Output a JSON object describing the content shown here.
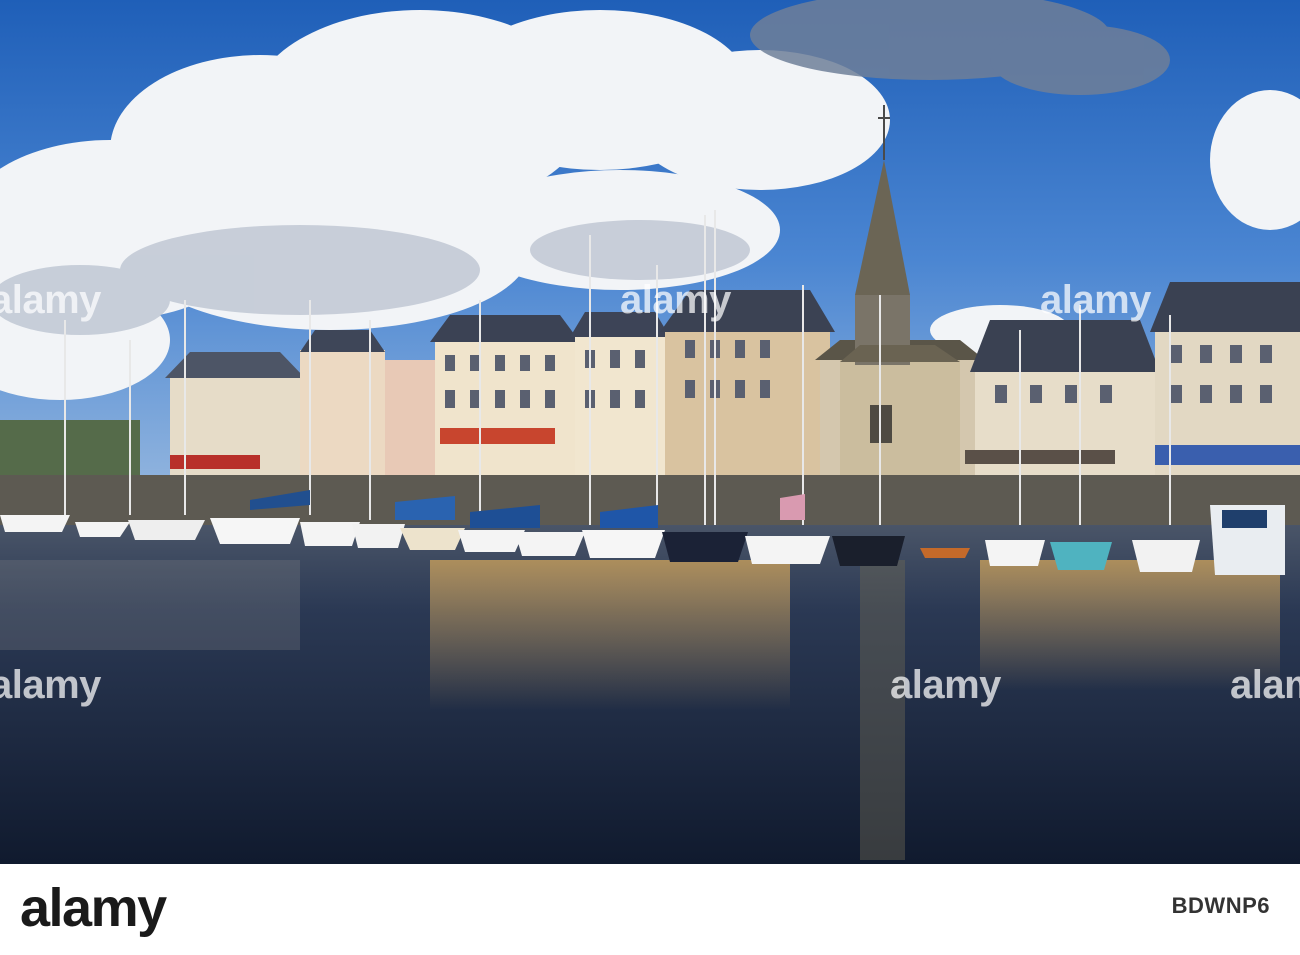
{
  "photo": {
    "subject": "harbour-with-boats-and-church-spire",
    "colors": {
      "sky_top": "#1f5fb8",
      "cloud": "#f2f4f7",
      "water": "#1b2a44",
      "reflection_gold": "#b38a4a",
      "spire": "#6b6555"
    }
  },
  "watermark": {
    "text": "alamy",
    "color": "#ffffff"
  },
  "footer": {
    "logo": "alamy",
    "image_id": "BDWNP6"
  }
}
